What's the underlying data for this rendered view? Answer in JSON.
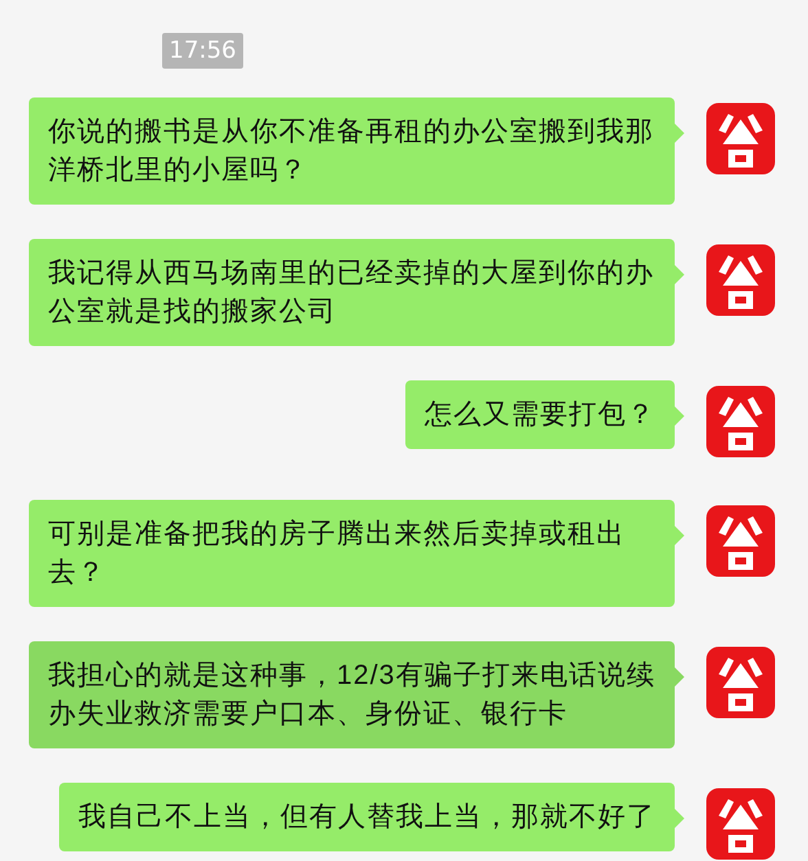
{
  "timestamp": "17:56",
  "messages": [
    {
      "text": "你说的搬书是从你不准备再租的办公室搬到我那洋桥北里的小屋吗？",
      "highlighted": false
    },
    {
      "text": "我记得从西马场南里的已经卖掉的大屋到你的办公室就是找的搬家公司",
      "highlighted": false
    },
    {
      "text": "怎么又需要打包？",
      "highlighted": false
    },
    {
      "text": "可别是准备把我的房子腾出来然后卖掉或租出去？",
      "highlighted": false
    },
    {
      "text": "我担心的就是这种事，12/3有骗子打来电话说续办失业救济需要户口本、身份证、银行卡",
      "highlighted": true
    },
    {
      "text": "我自己不上当，但有人替我上当，那就不好了",
      "highlighted": false
    }
  ]
}
